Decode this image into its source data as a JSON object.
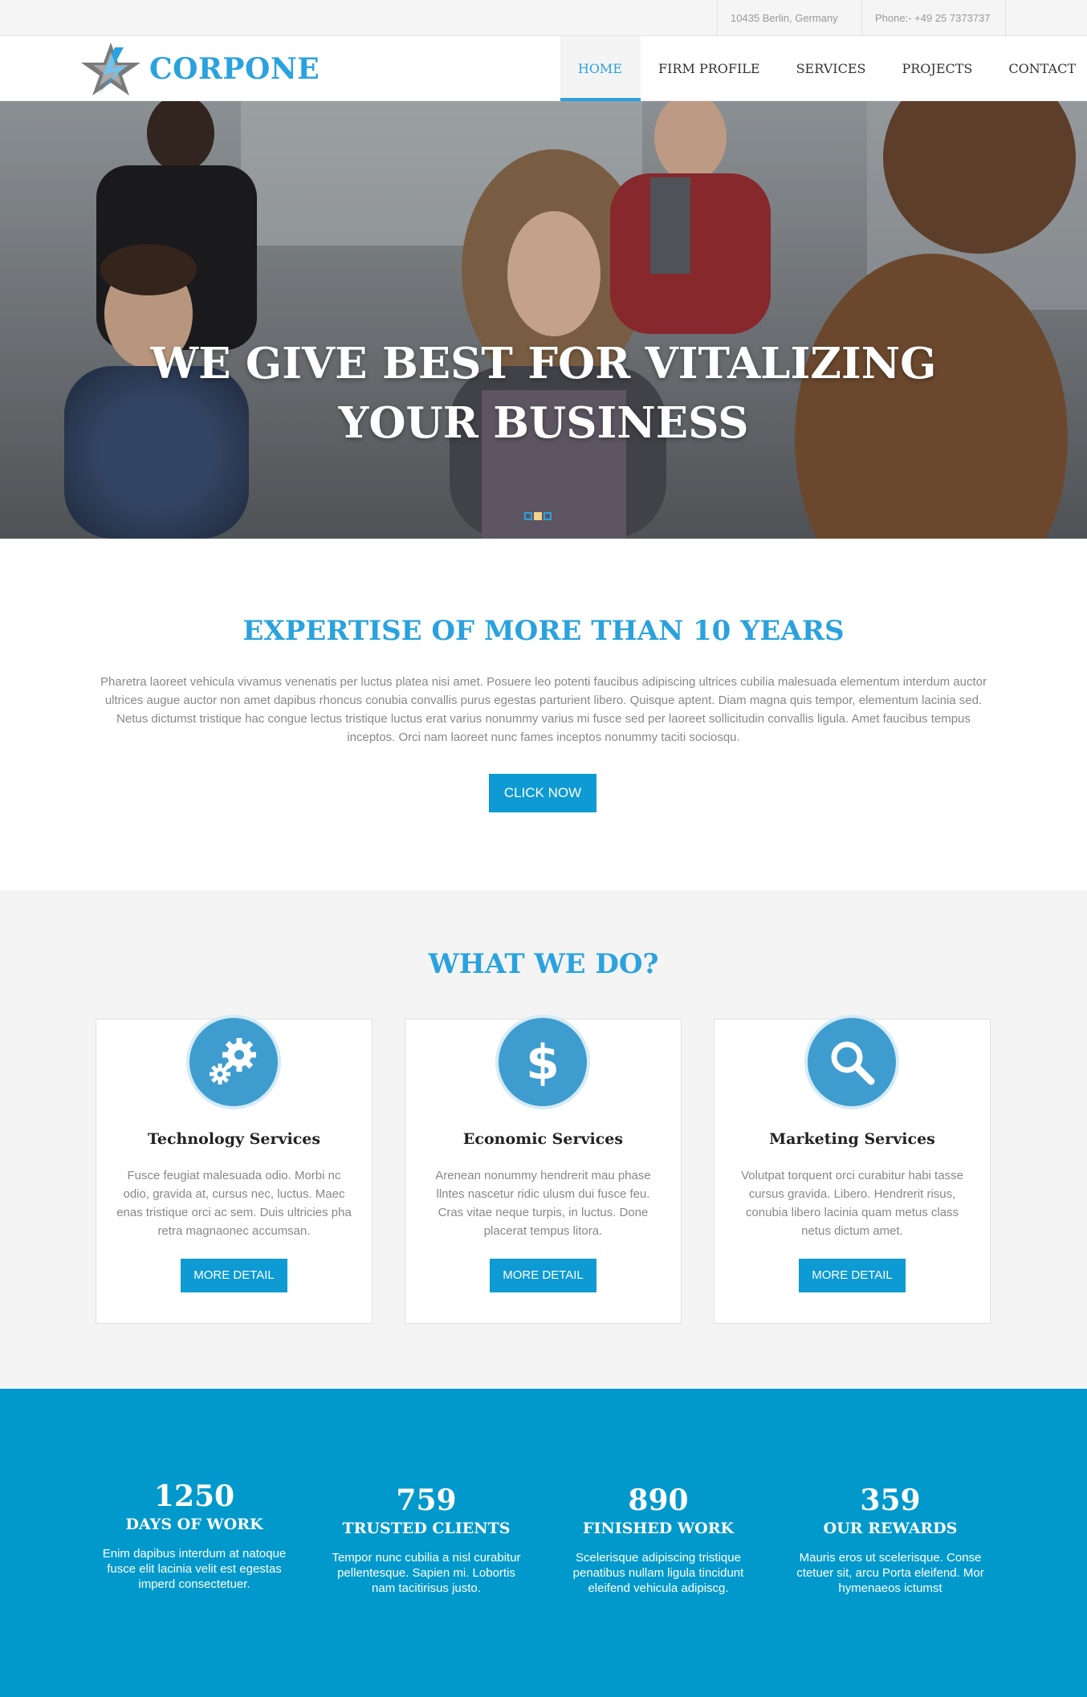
{
  "topbar": {
    "address": "10435 Berlin, Germany",
    "phone": "Phone:- +49 25 7373737"
  },
  "header": {
    "brand": "CORPONE",
    "nav": [
      {
        "label": "HOME",
        "active": true
      },
      {
        "label": "FIRM PROFILE",
        "active": false
      },
      {
        "label": "SERVICES",
        "active": false
      },
      {
        "label": "PROJECTS",
        "active": false
      },
      {
        "label": "CONTACT",
        "active": false
      }
    ]
  },
  "hero": {
    "headline_line1": "WE GIVE BEST FOR VITALIZING",
    "headline_line2": "YOUR BUSINESS",
    "slides_total": 3,
    "slide_active": 2
  },
  "expertise": {
    "title": "EXPERTISE OF MORE THAN 10 YEARS",
    "body": "Pharetra laoreet vehicula vivamus venenatis per luctus platea nisi amet. Posuere leo potenti faucibus adipiscing ultrices cubilia malesuada elementum interdum auctor ultrices augue auctor non amet dapibus rhoncus conubia convallis purus egestas parturient libero. Quisque aptent. Diam magna quis tempor, elementum lacinia sed. Netus dictumst tristique hac congue lectus tristique luctus erat varius nonummy varius mi fusce sed per laoreet sollicitudin convallis ligula. Amet faucibus tempus inceptos. Orci nam laoreet nunc fames inceptos nonummy taciti sociosqu.",
    "button": "CLICK NOW"
  },
  "services": {
    "title": "WHAT WE DO?",
    "cards": [
      {
        "icon": "gears-icon",
        "title": "Technology Services",
        "desc": "Fusce feugiat malesuada odio. Morbi nc odio, gravida at, cursus nec, luctus. Maec enas tristique orci ac sem. Duis ultricies pha retra magnaonec accumsan.",
        "button": "MORE DETAIL"
      },
      {
        "icon": "dollar-icon",
        "title": "Economic Services",
        "desc": "Arenean nonummy hendrerit mau phase llntes nascetur ridic ulusm dui fusce feu. Cras vitae neque turpis, in luctus. Done  placerat tempus litora.",
        "button": "MORE DETAIL"
      },
      {
        "icon": "search-icon",
        "title": "Marketing Services",
        "desc": "Volutpat torquent orci curabitur habi tasse cursus gravida. Libero. Hendrerit risus, conubia libero lacinia quam metus class netus dictum amet.",
        "button": "MORE DETAIL"
      }
    ]
  },
  "stats": [
    {
      "number": "1250",
      "label": "DAYS OF WORK",
      "text": "Enim dapibus interdum at natoque fusce elit lacinia velit est egestas imperd consectetuer."
    },
    {
      "number": "759",
      "label": "TRUSTED CLIENTS",
      "text": "Tempor nunc cubilia a nisl curabitur pellentesque. Sapien mi. Lobortis nam tacitirisus justo."
    },
    {
      "number": "890",
      "label": "FINISHED WORK",
      "text": "Scelerisque adipiscing tristique penatibus nullam ligula tincidunt eleifend vehicula adipiscg."
    },
    {
      "number": "359",
      "label": "OUR REWARDS",
      "text": "Mauris eros ut scelerisque. Conse ctetuer sit, arcu Porta eleifend. Mor hymenaeos ictumst"
    }
  ],
  "colors": {
    "accent": "#2aa2de",
    "button": "#0e9ad3",
    "stats_bg": "#0199cc",
    "icon_circle": "#3f9ccf"
  }
}
